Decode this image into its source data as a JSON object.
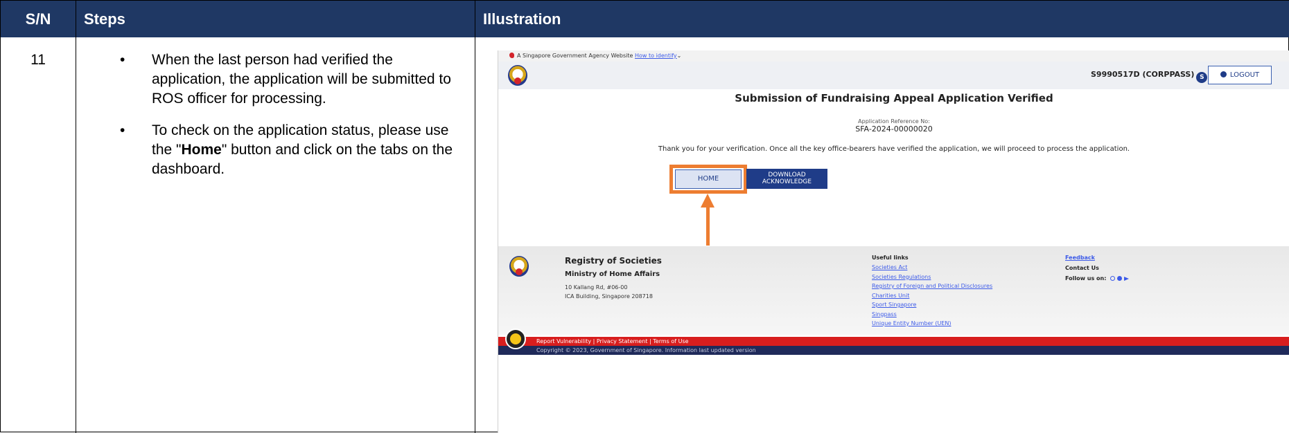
{
  "table": {
    "headers": {
      "sn": "S/N",
      "steps": "Steps",
      "illustration": "Illustration"
    },
    "row": {
      "sn": "11",
      "steps": [
        {
          "parts": [
            "When the last person had verified the application, the application will be submitted to ROS officer for processing."
          ]
        },
        {
          "pre": "To check on the application status, please use the \"",
          "bold": "Home",
          "post": "\" button and click on the tabs on the dashboard."
        }
      ]
    }
  },
  "screenshot": {
    "gov_banner": {
      "text": "A Singapore Government Agency Website",
      "link": "How to identify",
      "chevron": "⌄"
    },
    "user": {
      "id": "S9990517D (CORPPASS)",
      "badge": "S"
    },
    "logout_label": "LOGOUT",
    "page_title": "Submission of Fundraising Appeal Application Verified",
    "ref_label": "Application Reference No:",
    "ref_value": "SFA-2024-00000020",
    "message": "Thank you for your verification. Once all the key office-bearers have verified the application, we will proceed to process the application.",
    "home_label": "HOME",
    "download_label_1": "DOWNLOAD",
    "download_label_2": "ACKNOWLEDGE",
    "highlight_color": "#ed7d31",
    "footer": {
      "org": "Registry of Societies",
      "ministry": "Ministry of Home Affairs",
      "address_1": "10 Kallang Rd, #06-00",
      "address_2": "ICA Building, Singapore 208718",
      "useful_title": "Useful links",
      "useful_links": [
        "Societies Act",
        "Societies Regulations",
        "Registry of Foreign and Political Disclosures",
        "Charities Unit",
        "Sport Singapore",
        "Singpass",
        "Unique Entity Number (UEN)"
      ],
      "feedback": "Feedback",
      "contact": "Contact Us",
      "follow": "Follow us on:"
    },
    "legal_links": "Report Vulnerability | Privacy Statement | Terms of Use",
    "copyright": "Copyright © 2023, Government of Singapore. Information last updated version"
  }
}
